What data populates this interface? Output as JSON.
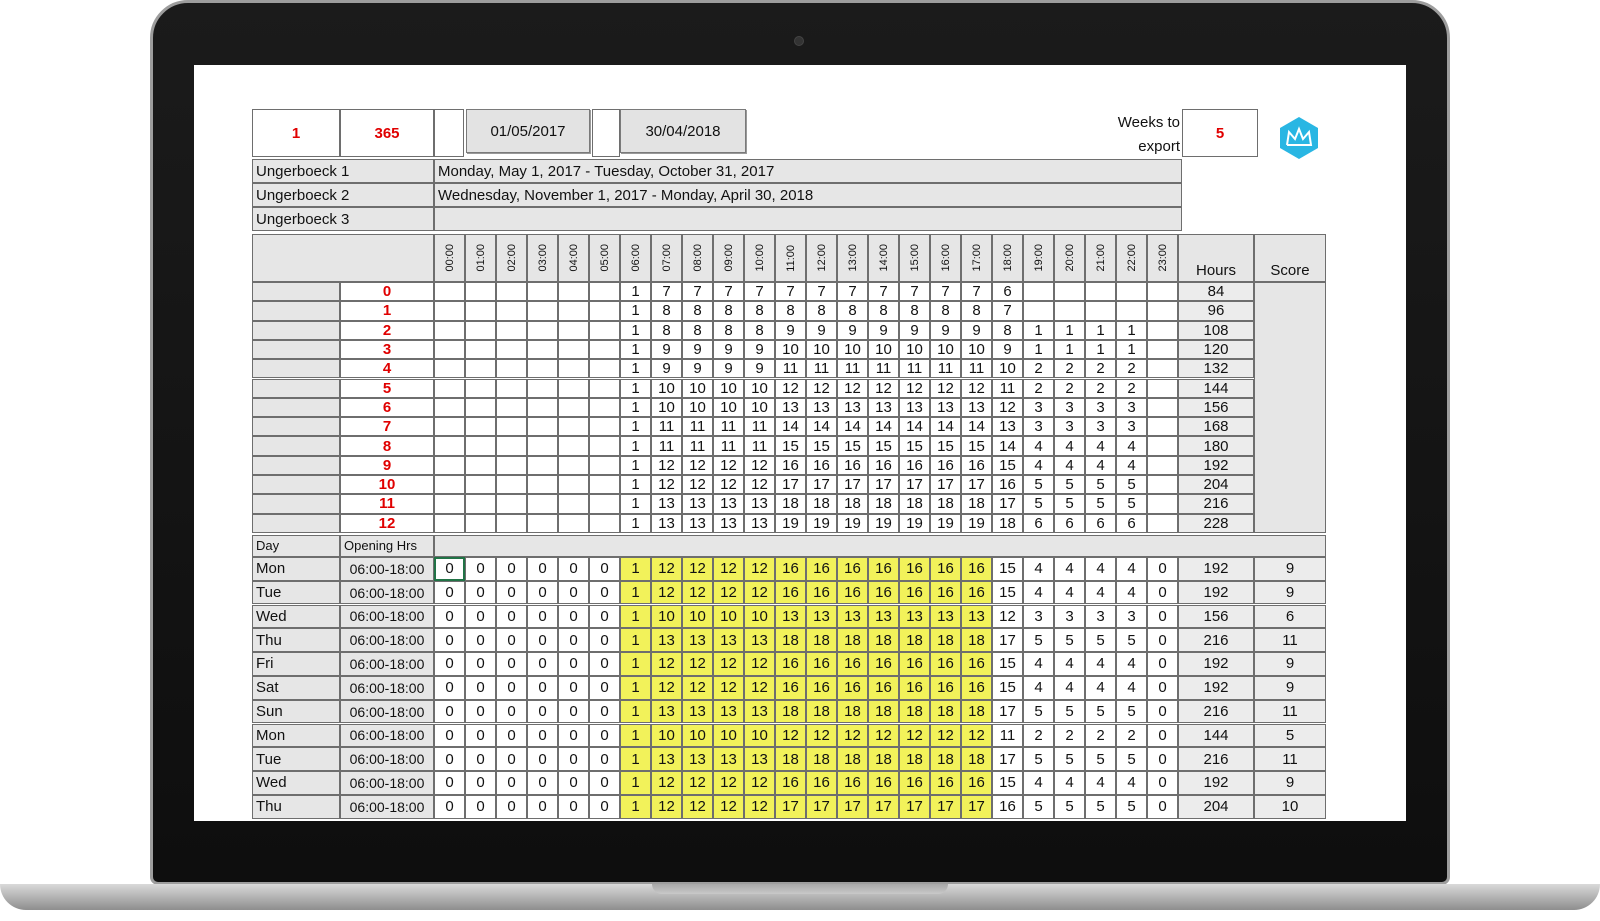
{
  "header": {
    "cell_a": "1",
    "cell_b": "365",
    "start_date": "01/05/2017",
    "end_date": "30/04/2018",
    "weeks_label_1": "Weeks to",
    "weeks_label_2": "export",
    "weeks_value": "5"
  },
  "periods": [
    {
      "name": "Ungerboeck 1",
      "range": "Monday, May 1, 2017 - Tuesday, October 31, 2017"
    },
    {
      "name": "Ungerboeck 2",
      "range": "Wednesday, November 1, 2017 - Monday, April 30, 2018"
    },
    {
      "name": "Ungerboeck 3",
      "range": ""
    }
  ],
  "hour_columns": [
    "00:00",
    "01:00",
    "02:00",
    "03:00",
    "04:00",
    "05:00",
    "06:00",
    "07:00",
    "08:00",
    "09:00",
    "10:00",
    "11:00",
    "12:00",
    "13:00",
    "14:00",
    "15:00",
    "16:00",
    "17:00",
    "18:00",
    "19:00",
    "20:00",
    "21:00",
    "22:00",
    "23:00"
  ],
  "hours_label": "Hours",
  "score_label": "Score",
  "levels": [
    {
      "level": "0",
      "cells": [
        "",
        "",
        "",
        "",
        "",
        "",
        "1",
        "7",
        "7",
        "7",
        "7",
        "7",
        "7",
        "7",
        "7",
        "7",
        "7",
        "7",
        "6",
        "",
        "",
        "",
        "",
        ""
      ],
      "hours": "84"
    },
    {
      "level": "1",
      "cells": [
        "",
        "",
        "",
        "",
        "",
        "",
        "1",
        "8",
        "8",
        "8",
        "8",
        "8",
        "8",
        "8",
        "8",
        "8",
        "8",
        "8",
        "7",
        "",
        "",
        "",
        "",
        ""
      ],
      "hours": "96"
    },
    {
      "level": "2",
      "cells": [
        "",
        "",
        "",
        "",
        "",
        "",
        "1",
        "8",
        "8",
        "8",
        "8",
        "9",
        "9",
        "9",
        "9",
        "9",
        "9",
        "9",
        "8",
        "1",
        "1",
        "1",
        "1",
        ""
      ],
      "hours": "108"
    },
    {
      "level": "3",
      "cells": [
        "",
        "",
        "",
        "",
        "",
        "",
        "1",
        "9",
        "9",
        "9",
        "9",
        "10",
        "10",
        "10",
        "10",
        "10",
        "10",
        "10",
        "9",
        "1",
        "1",
        "1",
        "1",
        ""
      ],
      "hours": "120"
    },
    {
      "level": "4",
      "cells": [
        "",
        "",
        "",
        "",
        "",
        "",
        "1",
        "9",
        "9",
        "9",
        "9",
        "11",
        "11",
        "11",
        "11",
        "11",
        "11",
        "11",
        "10",
        "2",
        "2",
        "2",
        "2",
        ""
      ],
      "hours": "132"
    },
    {
      "level": "5",
      "cells": [
        "",
        "",
        "",
        "",
        "",
        "",
        "1",
        "10",
        "10",
        "10",
        "10",
        "12",
        "12",
        "12",
        "12",
        "12",
        "12",
        "12",
        "11",
        "2",
        "2",
        "2",
        "2",
        ""
      ],
      "hours": "144"
    },
    {
      "level": "6",
      "cells": [
        "",
        "",
        "",
        "",
        "",
        "",
        "1",
        "10",
        "10",
        "10",
        "10",
        "13",
        "13",
        "13",
        "13",
        "13",
        "13",
        "13",
        "12",
        "3",
        "3",
        "3",
        "3",
        ""
      ],
      "hours": "156"
    },
    {
      "level": "7",
      "cells": [
        "",
        "",
        "",
        "",
        "",
        "",
        "1",
        "11",
        "11",
        "11",
        "11",
        "14",
        "14",
        "14",
        "14",
        "14",
        "14",
        "14",
        "13",
        "3",
        "3",
        "3",
        "3",
        ""
      ],
      "hours": "168"
    },
    {
      "level": "8",
      "cells": [
        "",
        "",
        "",
        "",
        "",
        "",
        "1",
        "11",
        "11",
        "11",
        "11",
        "15",
        "15",
        "15",
        "15",
        "15",
        "15",
        "15",
        "14",
        "4",
        "4",
        "4",
        "4",
        ""
      ],
      "hours": "180"
    },
    {
      "level": "9",
      "cells": [
        "",
        "",
        "",
        "",
        "",
        "",
        "1",
        "12",
        "12",
        "12",
        "12",
        "16",
        "16",
        "16",
        "16",
        "16",
        "16",
        "16",
        "15",
        "4",
        "4",
        "4",
        "4",
        ""
      ],
      "hours": "192"
    },
    {
      "level": "10",
      "cells": [
        "",
        "",
        "",
        "",
        "",
        "",
        "1",
        "12",
        "12",
        "12",
        "12",
        "17",
        "17",
        "17",
        "17",
        "17",
        "17",
        "17",
        "16",
        "5",
        "5",
        "5",
        "5",
        ""
      ],
      "hours": "204"
    },
    {
      "level": "11",
      "cells": [
        "",
        "",
        "",
        "",
        "",
        "",
        "1",
        "13",
        "13",
        "13",
        "13",
        "18",
        "18",
        "18",
        "18",
        "18",
        "18",
        "18",
        "17",
        "5",
        "5",
        "5",
        "5",
        ""
      ],
      "hours": "216"
    },
    {
      "level": "12",
      "cells": [
        "",
        "",
        "",
        "",
        "",
        "",
        "1",
        "13",
        "13",
        "13",
        "13",
        "19",
        "19",
        "19",
        "19",
        "19",
        "19",
        "19",
        "18",
        "6",
        "6",
        "6",
        "6",
        ""
      ],
      "hours": "228"
    }
  ],
  "schedule_headers": {
    "day": "Day",
    "opening": "Opening Hrs"
  },
  "schedule": [
    {
      "day": "Mon",
      "hrs": "06:00-18:00",
      "cells": [
        "0",
        "0",
        "0",
        "0",
        "0",
        "0",
        "1",
        "12",
        "12",
        "12",
        "12",
        "16",
        "16",
        "16",
        "16",
        "16",
        "16",
        "16",
        "15",
        "4",
        "4",
        "4",
        "4",
        "0"
      ],
      "hours": "192",
      "score": "9"
    },
    {
      "day": "Tue",
      "hrs": "06:00-18:00",
      "cells": [
        "0",
        "0",
        "0",
        "0",
        "0",
        "0",
        "1",
        "12",
        "12",
        "12",
        "12",
        "16",
        "16",
        "16",
        "16",
        "16",
        "16",
        "16",
        "15",
        "4",
        "4",
        "4",
        "4",
        "0"
      ],
      "hours": "192",
      "score": "9"
    },
    {
      "day": "Wed",
      "hrs": "06:00-18:00",
      "cells": [
        "0",
        "0",
        "0",
        "0",
        "0",
        "0",
        "1",
        "10",
        "10",
        "10",
        "10",
        "13",
        "13",
        "13",
        "13",
        "13",
        "13",
        "13",
        "12",
        "3",
        "3",
        "3",
        "3",
        "0"
      ],
      "hours": "156",
      "score": "6"
    },
    {
      "day": "Thu",
      "hrs": "06:00-18:00",
      "cells": [
        "0",
        "0",
        "0",
        "0",
        "0",
        "0",
        "1",
        "13",
        "13",
        "13",
        "13",
        "18",
        "18",
        "18",
        "18",
        "18",
        "18",
        "18",
        "17",
        "5",
        "5",
        "5",
        "5",
        "0"
      ],
      "hours": "216",
      "score": "11"
    },
    {
      "day": "Fri",
      "hrs": "06:00-18:00",
      "cells": [
        "0",
        "0",
        "0",
        "0",
        "0",
        "0",
        "1",
        "12",
        "12",
        "12",
        "12",
        "16",
        "16",
        "16",
        "16",
        "16",
        "16",
        "16",
        "15",
        "4",
        "4",
        "4",
        "4",
        "0"
      ],
      "hours": "192",
      "score": "9"
    },
    {
      "day": "Sat",
      "hrs": "06:00-18:00",
      "cells": [
        "0",
        "0",
        "0",
        "0",
        "0",
        "0",
        "1",
        "12",
        "12",
        "12",
        "12",
        "16",
        "16",
        "16",
        "16",
        "16",
        "16",
        "16",
        "15",
        "4",
        "4",
        "4",
        "4",
        "0"
      ],
      "hours": "192",
      "score": "9"
    },
    {
      "day": "Sun",
      "hrs": "06:00-18:00",
      "cells": [
        "0",
        "0",
        "0",
        "0",
        "0",
        "0",
        "1",
        "13",
        "13",
        "13",
        "13",
        "18",
        "18",
        "18",
        "18",
        "18",
        "18",
        "18",
        "17",
        "5",
        "5",
        "5",
        "5",
        "0"
      ],
      "hours": "216",
      "score": "11"
    },
    {
      "day": "Mon",
      "hrs": "06:00-18:00",
      "cells": [
        "0",
        "0",
        "0",
        "0",
        "0",
        "0",
        "1",
        "10",
        "10",
        "10",
        "10",
        "12",
        "12",
        "12",
        "12",
        "12",
        "12",
        "12",
        "11",
        "2",
        "2",
        "2",
        "2",
        "0"
      ],
      "hours": "144",
      "score": "5"
    },
    {
      "day": "Tue",
      "hrs": "06:00-18:00",
      "cells": [
        "0",
        "0",
        "0",
        "0",
        "0",
        "0",
        "1",
        "13",
        "13",
        "13",
        "13",
        "18",
        "18",
        "18",
        "18",
        "18",
        "18",
        "18",
        "17",
        "5",
        "5",
        "5",
        "5",
        "0"
      ],
      "hours": "216",
      "score": "11"
    },
    {
      "day": "Wed",
      "hrs": "06:00-18:00",
      "cells": [
        "0",
        "0",
        "0",
        "0",
        "0",
        "0",
        "1",
        "12",
        "12",
        "12",
        "12",
        "16",
        "16",
        "16",
        "16",
        "16",
        "16",
        "16",
        "15",
        "4",
        "4",
        "4",
        "4",
        "0"
      ],
      "hours": "192",
      "score": "9"
    },
    {
      "day": "Thu",
      "hrs": "06:00-18:00",
      "cells": [
        "0",
        "0",
        "0",
        "0",
        "0",
        "0",
        "1",
        "12",
        "12",
        "12",
        "12",
        "17",
        "17",
        "17",
        "17",
        "17",
        "17",
        "17",
        "16",
        "5",
        "5",
        "5",
        "5",
        "0"
      ],
      "hours": "204",
      "score": "10"
    }
  ],
  "colors": {
    "highlight": "#f2f25a",
    "level_text": "#e00000",
    "logo": "#29b6e3"
  },
  "icons": {
    "logo": "crown-logo-icon"
  }
}
